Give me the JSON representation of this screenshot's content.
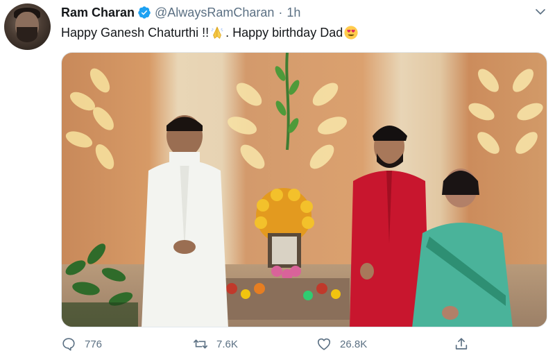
{
  "tweet": {
    "display_name": "Ram Charan",
    "handle": "@AlwaysRamCharan",
    "separator": "·",
    "time": "1h",
    "text_part1": "Happy Ganesh Chaturthi !!",
    "text_part2": ". Happy birthday Dad",
    "emoji_1": "folded-hands-emoji",
    "emoji_2": "heart-eyes-emoji"
  },
  "actions": {
    "reply_count": "776",
    "retweet_count": "7.6K",
    "like_count": "26.8K"
  },
  "colors": {
    "verified": "#1da1f2",
    "muted": "#5b7083",
    "text": "#14171a"
  }
}
